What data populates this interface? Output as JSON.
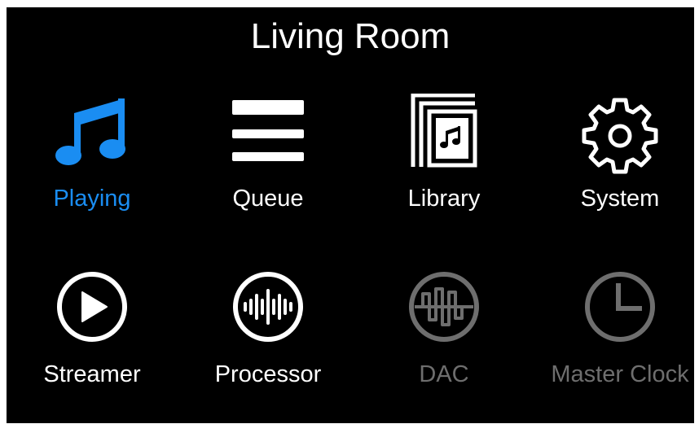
{
  "header": {
    "title": "Living Room"
  },
  "colors": {
    "active": "#1a8df2",
    "normal": "#ffffff",
    "disabled": "#6e6e6e",
    "background": "#000000"
  },
  "menu": {
    "items": [
      {
        "label": "Playing",
        "icon": "music-note-icon",
        "state": "active"
      },
      {
        "label": "Queue",
        "icon": "queue-list-icon",
        "state": "enabled"
      },
      {
        "label": "Library",
        "icon": "library-icon",
        "state": "enabled"
      },
      {
        "label": "System",
        "icon": "gear-icon",
        "state": "enabled"
      },
      {
        "label": "Streamer",
        "icon": "play-circle-icon",
        "state": "enabled"
      },
      {
        "label": "Processor",
        "icon": "waveform-icon",
        "state": "enabled"
      },
      {
        "label": "DAC",
        "icon": "dac-waveform-icon",
        "state": "disabled"
      },
      {
        "label": "Master Clock",
        "icon": "clock-icon",
        "state": "disabled"
      }
    ]
  }
}
